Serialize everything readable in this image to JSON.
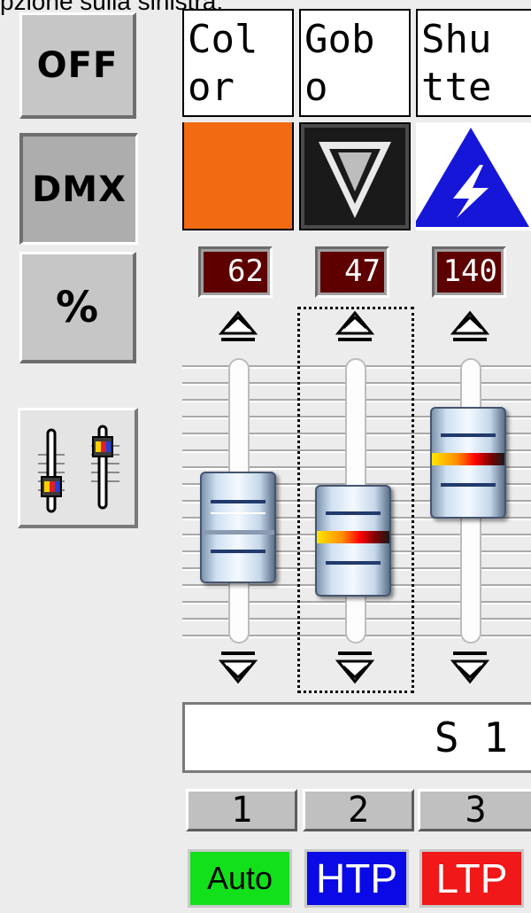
{
  "caption": "pzione sulla sinistra.",
  "mode_buttons": [
    {
      "label": "OFF"
    },
    {
      "label": "DMX"
    },
    {
      "label": "%"
    }
  ],
  "fader_tool_icon": "fader-mixer-icon",
  "channels": [
    {
      "name": "Color",
      "icon": "color-swatch-icon",
      "swatch_color": "#f26b12",
      "value": "62",
      "number": "1",
      "merge_mode": "Auto",
      "merge_color": "#12e01a",
      "merge_text_color": "#000000",
      "fader_level": 0.36
    },
    {
      "name": "Gobo",
      "icon": "gobo-triangle-icon",
      "value": "47",
      "number": "2",
      "merge_mode": "HTP",
      "merge_color": "#0a0ae6",
      "merge_text_color": "#ffffff",
      "fader_level": 0.29
    },
    {
      "name": "Shutter",
      "icon": "shutter-strobe-icon",
      "value": "140",
      "number": "3",
      "merge_mode": "LTP",
      "merge_color": "#f01818",
      "merge_text_color": "#ffffff",
      "fader_level": 0.7
    }
  ],
  "channel_name_lines": [
    [
      "Col",
      "or"
    ],
    [
      "Gob",
      "o"
    ],
    [
      "Shu",
      "tte"
    ]
  ],
  "scene_label": "S 1"
}
